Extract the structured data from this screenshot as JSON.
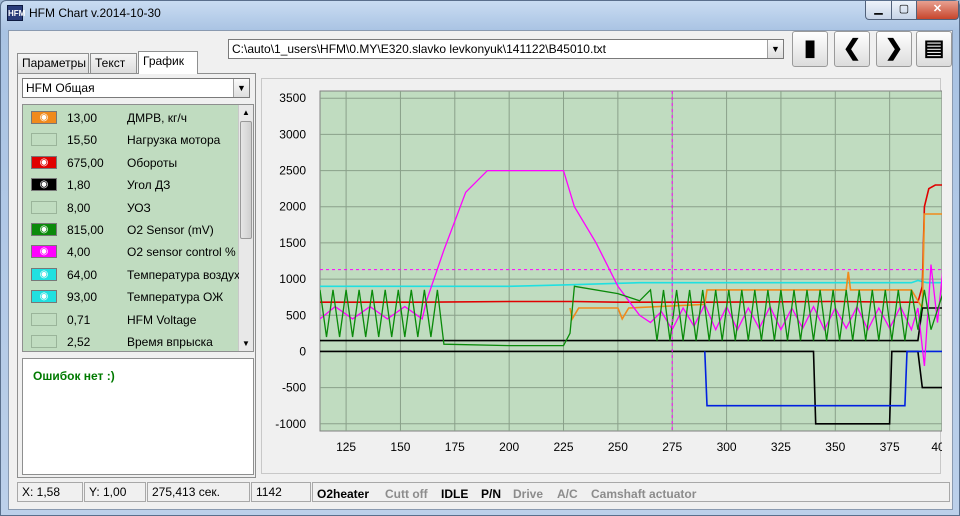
{
  "window": {
    "title": "HFM Chart   v.2014-10-30",
    "icon_text": "HFM"
  },
  "tabs": [
    {
      "label": "Параметры",
      "active": false
    },
    {
      "label": "Текст",
      "active": false
    },
    {
      "label": "График",
      "active": true
    }
  ],
  "profile_select": {
    "value": "HFM Общая"
  },
  "file_select": {
    "value": "C:\\auto\\1_users\\HFM\\0.MY\\E320.slavko levkonyuk\\141122\\B45010.txt"
  },
  "toolbar": [
    {
      "name": "open-file-button",
      "icon": "book-icon",
      "glyph": "▮"
    },
    {
      "name": "prev-button",
      "icon": "chevron-left-icon",
      "glyph": "❮"
    },
    {
      "name": "next-button",
      "icon": "chevron-right-icon",
      "glyph": "❯"
    },
    {
      "name": "clipboard-button",
      "icon": "clipboard-icon",
      "glyph": "▤"
    }
  ],
  "params": [
    {
      "value": "13,00",
      "name": "ДМРВ, кг/ч",
      "visible": true,
      "color": "#f08a1c"
    },
    {
      "value": "15,50",
      "name": "Нагрузка мотора",
      "visible": false,
      "color": ""
    },
    {
      "value": "675,00",
      "name": "Обороты",
      "visible": true,
      "color": "#e00000"
    },
    {
      "value": "1,80",
      "name": "Угол ДЗ",
      "visible": true,
      "color": "#000000"
    },
    {
      "value": "8,00",
      "name": "УОЗ",
      "visible": false,
      "color": ""
    },
    {
      "value": "815,00",
      "name": "O2 Sensor (mV)",
      "visible": true,
      "color": "#0a8a0a"
    },
    {
      "value": "4,00",
      "name": "O2 sensor control %",
      "visible": true,
      "color": "#ff00ff"
    },
    {
      "value": "64,00",
      "name": "Температура воздуха",
      "visible": true,
      "color": "#20e0e0"
    },
    {
      "value": "93,00",
      "name": "Температура ОЖ",
      "visible": true,
      "color": "#20e0e0"
    },
    {
      "value": "0,71",
      "name": "HFM Voltage",
      "visible": false,
      "color": ""
    },
    {
      "value": "2,52",
      "name": "Время впрыска",
      "visible": false,
      "color": ""
    }
  ],
  "errors": {
    "text": "Ошибок нет :)"
  },
  "status": {
    "x": "X: 1,58",
    "y": "Y: 1,00",
    "time": "275,413 сек.",
    "index": "1142",
    "flags": [
      {
        "label": "O2heater",
        "active": true
      },
      {
        "label": "Cutt off",
        "active": false
      },
      {
        "label": "IDLE",
        "active": true
      },
      {
        "label": "P/N",
        "active": true
      },
      {
        "label": "Drive",
        "active": false
      },
      {
        "label": "A/C",
        "active": false
      },
      {
        "label": "Camshaft actuator",
        "active": false
      }
    ]
  },
  "chart_data": {
    "type": "line",
    "xlim": [
      113,
      400
    ],
    "ylim": [
      -1100,
      3600
    ],
    "x_ticks": [
      125,
      150,
      175,
      200,
      225,
      250,
      275,
      300,
      325,
      350,
      375
    ],
    "x_tick_labels": [
      "125",
      "150",
      "175",
      "200",
      "225",
      "250",
      "275",
      "300",
      "325",
      "350",
      "375",
      "40"
    ],
    "y_ticks": [
      -1000,
      -500,
      0,
      500,
      1000,
      1500,
      2000,
      2500,
      3000,
      3500
    ],
    "grid": true,
    "background": "#c0dcc0",
    "cursor_x": 275,
    "cursor_y": 1130,
    "series": [
      {
        "color": "#20e0e0",
        "points": [
          [
            113,
            900
          ],
          [
            150,
            900
          ],
          [
            200,
            900
          ],
          [
            225,
            920
          ],
          [
            260,
            950
          ],
          [
            300,
            950
          ],
          [
            360,
            950
          ],
          [
            385,
            950
          ],
          [
            388,
            980
          ],
          [
            392,
            950
          ],
          [
            400,
            950
          ]
        ]
      },
      {
        "color": "#e00000",
        "points": [
          [
            113,
            680
          ],
          [
            160,
            680
          ],
          [
            200,
            690
          ],
          [
            230,
            690
          ],
          [
            250,
            680
          ],
          [
            290,
            680
          ],
          [
            350,
            690
          ],
          [
            380,
            680
          ],
          [
            388,
            680
          ],
          [
            390,
            900
          ],
          [
            391,
            2000
          ],
          [
            393,
            2250
          ],
          [
            396,
            2300
          ],
          [
            400,
            2300
          ]
        ]
      },
      {
        "color": "#f08a1c",
        "points": [
          [
            228,
            600
          ],
          [
            229,
            450
          ],
          [
            232,
            600
          ],
          [
            250,
            600
          ],
          [
            252,
            450
          ],
          [
            255,
            600
          ],
          [
            290,
            650
          ],
          [
            291,
            850
          ],
          [
            355,
            850
          ],
          [
            356,
            1100
          ],
          [
            357,
            850
          ],
          [
            385,
            850
          ],
          [
            390,
            600
          ],
          [
            391,
            1900
          ],
          [
            395,
            1900
          ],
          [
            400,
            1900
          ]
        ]
      },
      {
        "color": "#000000",
        "points": [
          [
            113,
            0
          ],
          [
            300,
            0
          ],
          [
            340,
            0
          ],
          [
            341,
            -1000
          ],
          [
            375,
            -1000
          ],
          [
            376,
            0
          ],
          [
            388,
            0
          ],
          [
            390,
            -500
          ],
          [
            400,
            -500
          ]
        ]
      },
      {
        "color": "#000000",
        "points": [
          [
            113,
            150
          ],
          [
            300,
            150
          ],
          [
            388,
            150
          ],
          [
            390,
            600
          ],
          [
            400,
            600
          ]
        ]
      },
      {
        "color": "#0020e0",
        "points": [
          [
            290,
            0
          ],
          [
            291,
            -750
          ],
          [
            382,
            -750
          ],
          [
            383,
            0
          ],
          [
            400,
            0
          ]
        ]
      },
      {
        "color": "#ff00ff",
        "points": [
          [
            113,
            450
          ],
          [
            120,
            620
          ],
          [
            128,
            450
          ],
          [
            136,
            620
          ],
          [
            144,
            450
          ],
          [
            152,
            620
          ],
          [
            160,
            450
          ],
          [
            162,
            700
          ],
          [
            170,
            1400
          ],
          [
            180,
            2200
          ],
          [
            190,
            2500
          ],
          [
            225,
            2500
          ],
          [
            230,
            2000
          ],
          [
            240,
            1500
          ],
          [
            250,
            900
          ],
          [
            255,
            700
          ],
          [
            260,
            500
          ],
          [
            265,
            400
          ],
          [
            270,
            550
          ],
          [
            275,
            300
          ],
          [
            280,
            600
          ],
          [
            285,
            350
          ],
          [
            290,
            650
          ],
          [
            295,
            300
          ],
          [
            300,
            620
          ],
          [
            305,
            300
          ],
          [
            310,
            600
          ],
          [
            315,
            320
          ],
          [
            320,
            620
          ],
          [
            325,
            300
          ],
          [
            330,
            600
          ],
          [
            335,
            320
          ],
          [
            340,
            620
          ],
          [
            345,
            300
          ],
          [
            350,
            600
          ],
          [
            355,
            320
          ],
          [
            360,
            620
          ],
          [
            365,
            300
          ],
          [
            370,
            600
          ],
          [
            375,
            320
          ],
          [
            380,
            620
          ],
          [
            385,
            300
          ],
          [
            388,
            600
          ],
          [
            391,
            -200
          ],
          [
            394,
            1200
          ],
          [
            397,
            400
          ],
          [
            400,
            1300
          ]
        ]
      },
      {
        "color": "#0a8a0a",
        "points": [
          [
            113,
            850
          ],
          [
            116,
            200
          ],
          [
            119,
            850
          ],
          [
            122,
            200
          ],
          [
            125,
            850
          ],
          [
            128,
            200
          ],
          [
            131,
            850
          ],
          [
            134,
            200
          ],
          [
            137,
            850
          ],
          [
            140,
            200
          ],
          [
            143,
            850
          ],
          [
            146,
            200
          ],
          [
            149,
            850
          ],
          [
            152,
            200
          ],
          [
            155,
            850
          ],
          [
            158,
            200
          ],
          [
            161,
            850
          ],
          [
            164,
            200
          ],
          [
            167,
            850
          ],
          [
            170,
            100
          ],
          [
            200,
            80
          ],
          [
            225,
            80
          ],
          [
            228,
            250
          ],
          [
            230,
            900
          ],
          [
            250,
            800
          ],
          [
            260,
            700
          ],
          [
            265,
            850
          ],
          [
            268,
            150
          ],
          [
            271,
            850
          ],
          [
            274,
            150
          ],
          [
            277,
            850
          ],
          [
            280,
            150
          ],
          [
            283,
            850
          ],
          [
            286,
            150
          ],
          [
            289,
            850
          ],
          [
            292,
            150
          ],
          [
            295,
            850
          ],
          [
            298,
            150
          ],
          [
            301,
            850
          ],
          [
            304,
            150
          ],
          [
            307,
            850
          ],
          [
            310,
            150
          ],
          [
            313,
            850
          ],
          [
            316,
            150
          ],
          [
            319,
            850
          ],
          [
            322,
            150
          ],
          [
            325,
            850
          ],
          [
            328,
            150
          ],
          [
            331,
            850
          ],
          [
            334,
            150
          ],
          [
            337,
            850
          ],
          [
            340,
            150
          ],
          [
            343,
            850
          ],
          [
            346,
            150
          ],
          [
            349,
            850
          ],
          [
            352,
            150
          ],
          [
            355,
            850
          ],
          [
            358,
            150
          ],
          [
            361,
            850
          ],
          [
            364,
            150
          ],
          [
            367,
            850
          ],
          [
            370,
            150
          ],
          [
            373,
            850
          ],
          [
            376,
            150
          ],
          [
            379,
            850
          ],
          [
            382,
            150
          ],
          [
            385,
            850
          ],
          [
            388,
            300
          ],
          [
            391,
            850
          ],
          [
            394,
            300
          ],
          [
            400,
            850
          ]
        ]
      }
    ]
  }
}
